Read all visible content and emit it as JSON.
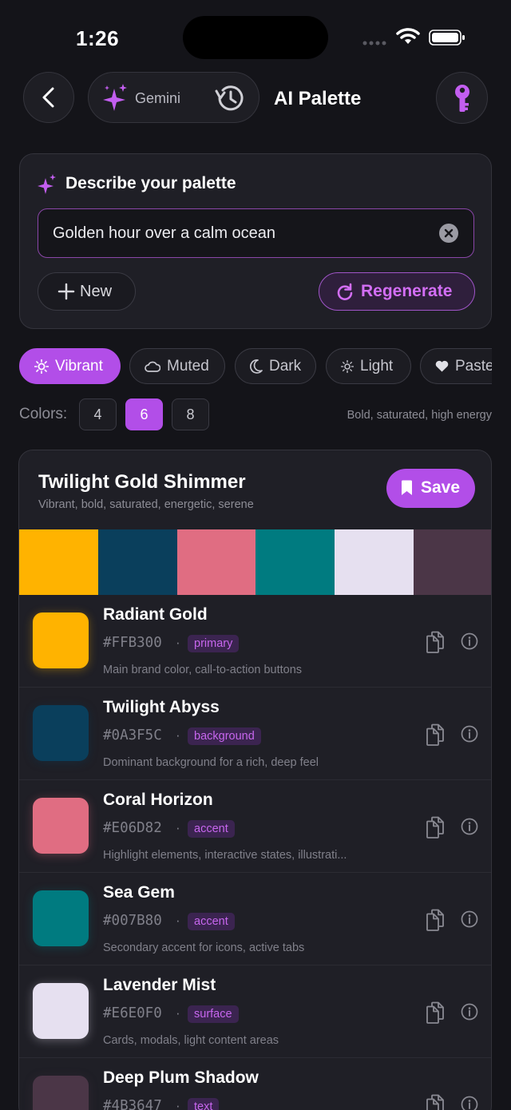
{
  "status_bar": {
    "time": "1:26"
  },
  "nav": {
    "model": "Gemini",
    "title": "AI Palette"
  },
  "prompt": {
    "heading": "Describe your palette",
    "value": "Golden hour over a calm ocean",
    "new_label": "New",
    "regenerate_label": "Regenerate"
  },
  "styles": [
    {
      "label": "Vibrant",
      "icon": "sun-icon",
      "active": true
    },
    {
      "label": "Muted",
      "icon": "cloud-icon",
      "active": false
    },
    {
      "label": "Dark",
      "icon": "moon-icon",
      "active": false
    },
    {
      "label": "Light",
      "icon": "sun-small-icon",
      "active": false
    },
    {
      "label": "Paste",
      "icon": "heart-icon",
      "active": false
    }
  ],
  "colors_count": {
    "label": "Colors:",
    "options": [
      "4",
      "6",
      "8"
    ],
    "selected": "6",
    "description": "Bold, saturated, high energy"
  },
  "palette": {
    "name": "Twilight Gold Shimmer",
    "tags": "Vibrant, bold, saturated, energetic, serene",
    "save_label": "Save",
    "colors": [
      {
        "name": "Radiant Gold",
        "hex": "#FFB300",
        "role": "primary",
        "use": "Main brand color, call-to-action buttons"
      },
      {
        "name": "Twilight Abyss",
        "hex": "#0A3F5C",
        "role": "background",
        "use": "Dominant background for a rich, deep feel"
      },
      {
        "name": "Coral Horizon",
        "hex": "#E06D82",
        "role": "accent",
        "use": "Highlight elements, interactive states, illustrati..."
      },
      {
        "name": "Sea Gem",
        "hex": "#007B80",
        "role": "accent",
        "use": "Secondary accent for icons, active tabs"
      },
      {
        "name": "Lavender Mist",
        "hex": "#E6E0F0",
        "role": "surface",
        "use": "Cards, modals, light content areas"
      },
      {
        "name": "Deep Plum Shadow",
        "hex": "#4B3647",
        "role": "text",
        "use": ""
      }
    ]
  },
  "theme": {
    "accent": "#B24EE8",
    "background": "#141419",
    "card": "#1F1F26"
  }
}
